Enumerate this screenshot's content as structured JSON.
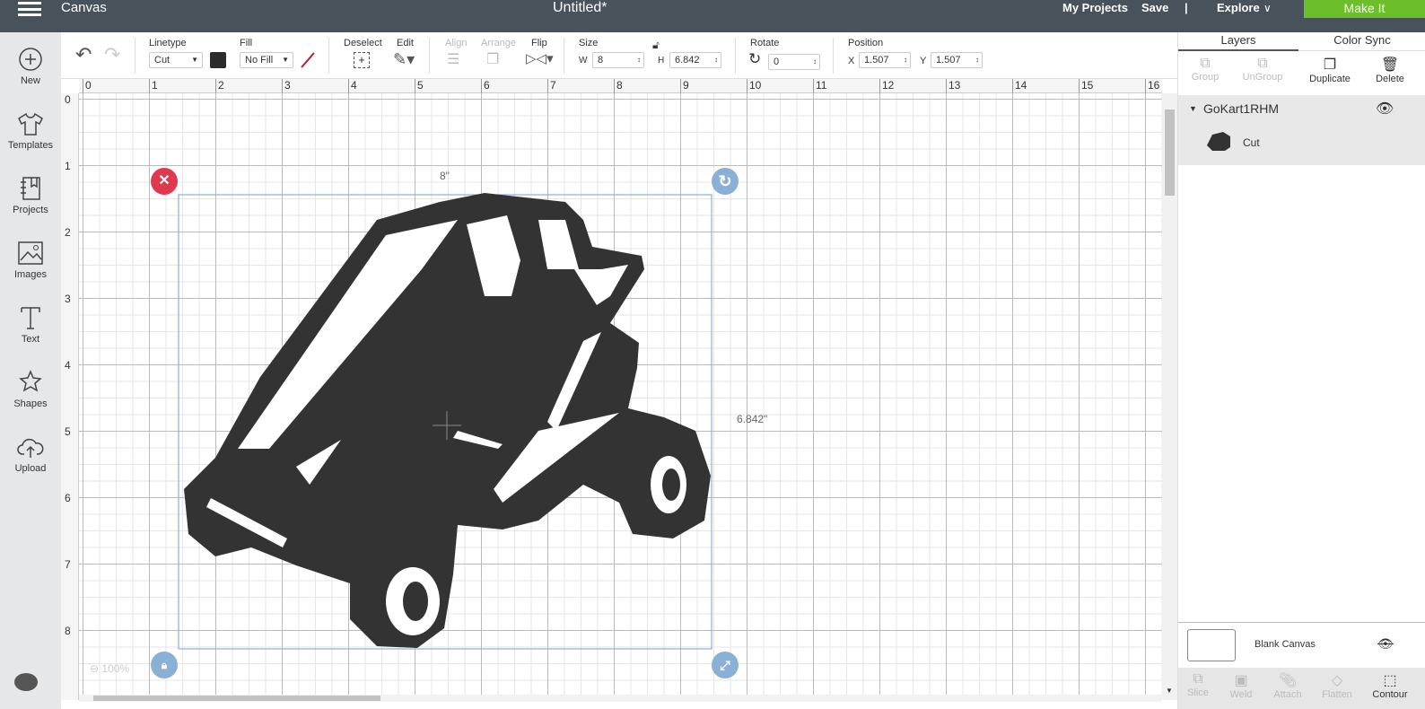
{
  "topbar": {
    "menu_icon": "hamburger-icon",
    "app": "Canvas",
    "title": "Untitled*",
    "my_projects": "My Projects",
    "save": "Save",
    "divider": "|",
    "explore": "Explore",
    "make_it": "Make It"
  },
  "leftnav": [
    {
      "label": "New",
      "icon": "plus-circle-icon"
    },
    {
      "label": "Templates",
      "icon": "shirt-icon"
    },
    {
      "label": "Projects",
      "icon": "notebook-icon"
    },
    {
      "label": "Images",
      "icon": "image-icon"
    },
    {
      "label": "Text",
      "icon": "text-icon"
    },
    {
      "label": "Shapes",
      "icon": "shapes-icon"
    },
    {
      "label": "Upload",
      "icon": "upload-icon"
    }
  ],
  "toolbar": {
    "linetype_label": "Linetype",
    "linetype": "Cut",
    "fill_label": "Fill",
    "fill": "No Fill",
    "deselect": "Deselect",
    "edit": "Edit",
    "align": "Align",
    "arrange": "Arrange",
    "flip": "Flip",
    "size": "Size",
    "w_label": "W",
    "w": "8",
    "h_label": "H",
    "h": "6.842",
    "rotate": "Rotate",
    "rotate_value": "0",
    "position": "Position",
    "x_label": "X",
    "x": "1.507",
    "y_label": "Y",
    "y": "1.507",
    "line_color": "#2b2b2b"
  },
  "ruler": {
    "top": [
      "0",
      "1",
      "2",
      "3",
      "4",
      "5",
      "6",
      "7",
      "8",
      "9",
      "10",
      "11",
      "12",
      "13",
      "14",
      "15",
      "16"
    ],
    "left": [
      "0",
      "1",
      "2",
      "3",
      "4",
      "5",
      "6",
      "7",
      "8"
    ]
  },
  "canvas": {
    "width_label": "8\"",
    "height_label": "6.842\"",
    "zoom": "100%"
  },
  "panel": {
    "tabs": [
      "Layers",
      "Color Sync"
    ],
    "actions": [
      "Group",
      "UnGroup",
      "Duplicate",
      "Delete"
    ],
    "layer_name": "GoKart1RHM",
    "sublayer": "Cut",
    "blank_canvas": "Blank Canvas",
    "bottom": [
      "Slice",
      "Weld",
      "Attach",
      "Flatten",
      "Contour"
    ]
  }
}
